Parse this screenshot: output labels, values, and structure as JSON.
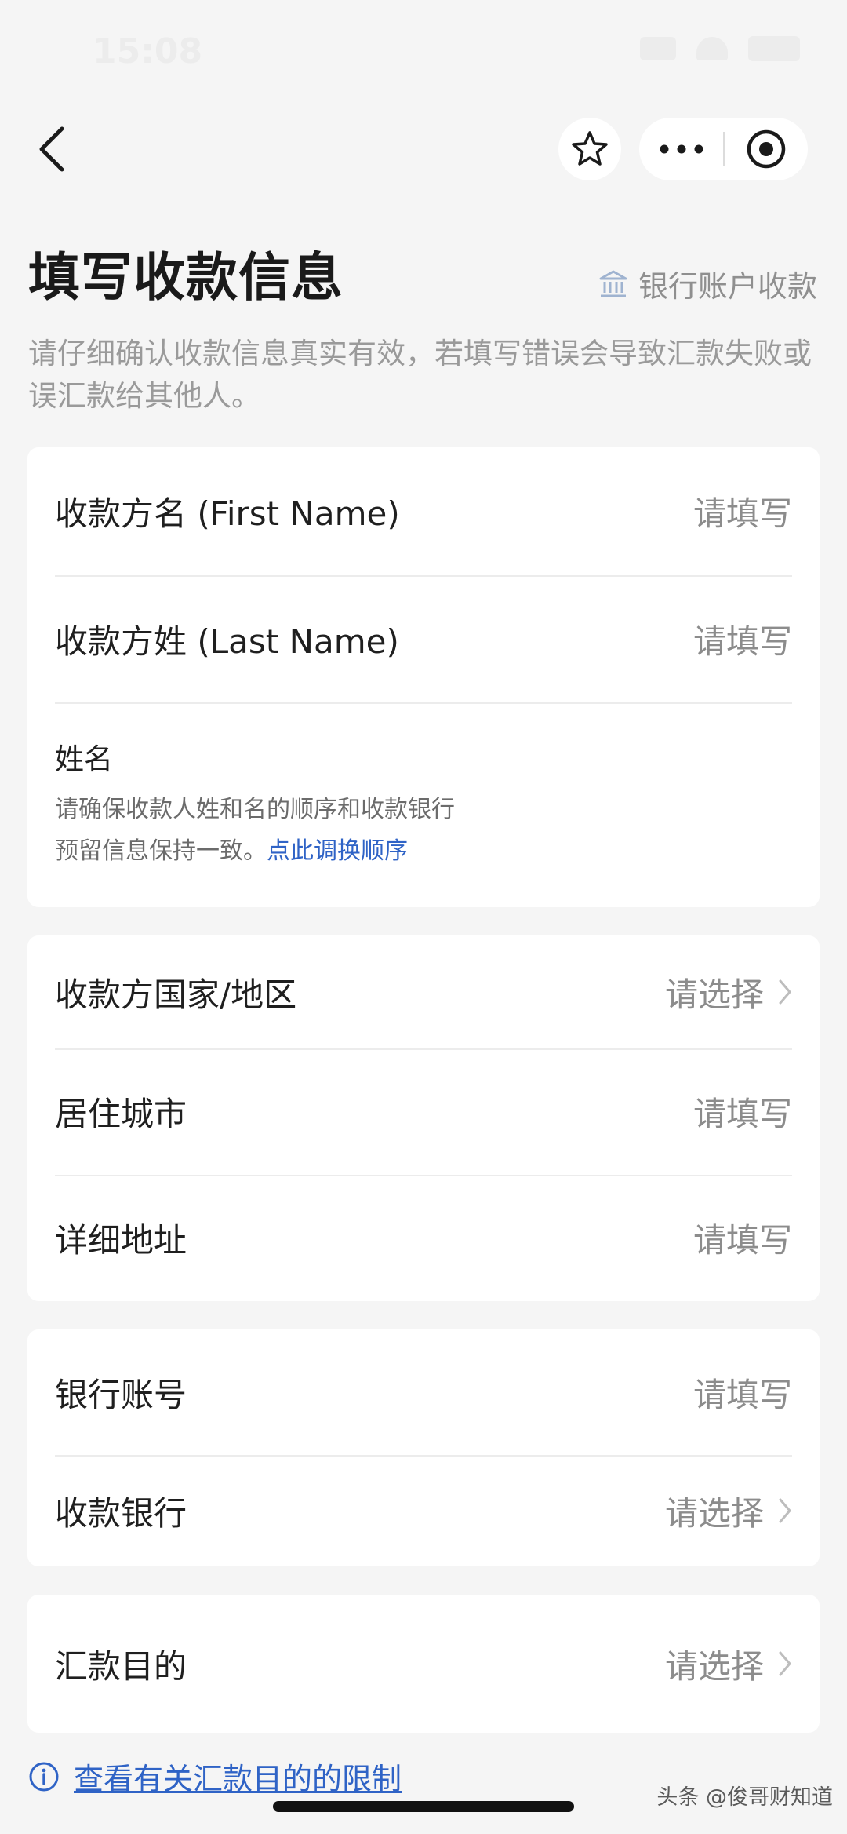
{
  "status_bar": {
    "time": "15:08"
  },
  "header": {
    "back_icon": "chevron-left-icon",
    "favorite_icon": "star-outline-icon",
    "more_icon": "more-dots-icon",
    "close_icon": "target-circle-icon"
  },
  "page": {
    "title": "填写收款信息",
    "bank_link_label": "银行账户收款",
    "subtitle": "请仔细确认收款信息真实有效，若填写错误会导致汇款失败或误汇款给其他人。"
  },
  "card_name": {
    "rows": [
      {
        "label": "收款方名 (First Name)",
        "placeholder": "请填写"
      },
      {
        "label": "收款方姓 (Last Name)",
        "placeholder": "请填写"
      }
    ],
    "name_title": "姓名",
    "name_hint_line1": "请确保收款人姓和名的顺序和收款银行",
    "name_hint_line2": "预留信息保持一致。",
    "swap_link": "点此调换顺序"
  },
  "card_address": {
    "rows": [
      {
        "label": "收款方国家/地区",
        "placeholder": "请选择"
      },
      {
        "label": "居住城市",
        "placeholder": "请填写"
      },
      {
        "label": "详细地址",
        "placeholder": "请填写"
      }
    ]
  },
  "card_bank": {
    "rows": [
      {
        "label": "银行账号",
        "placeholder": "请填写"
      },
      {
        "label": "收款银行",
        "placeholder": "请选择"
      }
    ]
  },
  "card_purpose": {
    "rows": [
      {
        "label": "汇款目的",
        "placeholder": "请选择"
      }
    ]
  },
  "footer": {
    "limit_link": "查看有关汇款目的的限制",
    "watermark": "头条 @俊哥财知道"
  },
  "colors": {
    "accent_blue": "#2f63c6",
    "background": "#f5f5f5",
    "card": "#ffffff"
  }
}
